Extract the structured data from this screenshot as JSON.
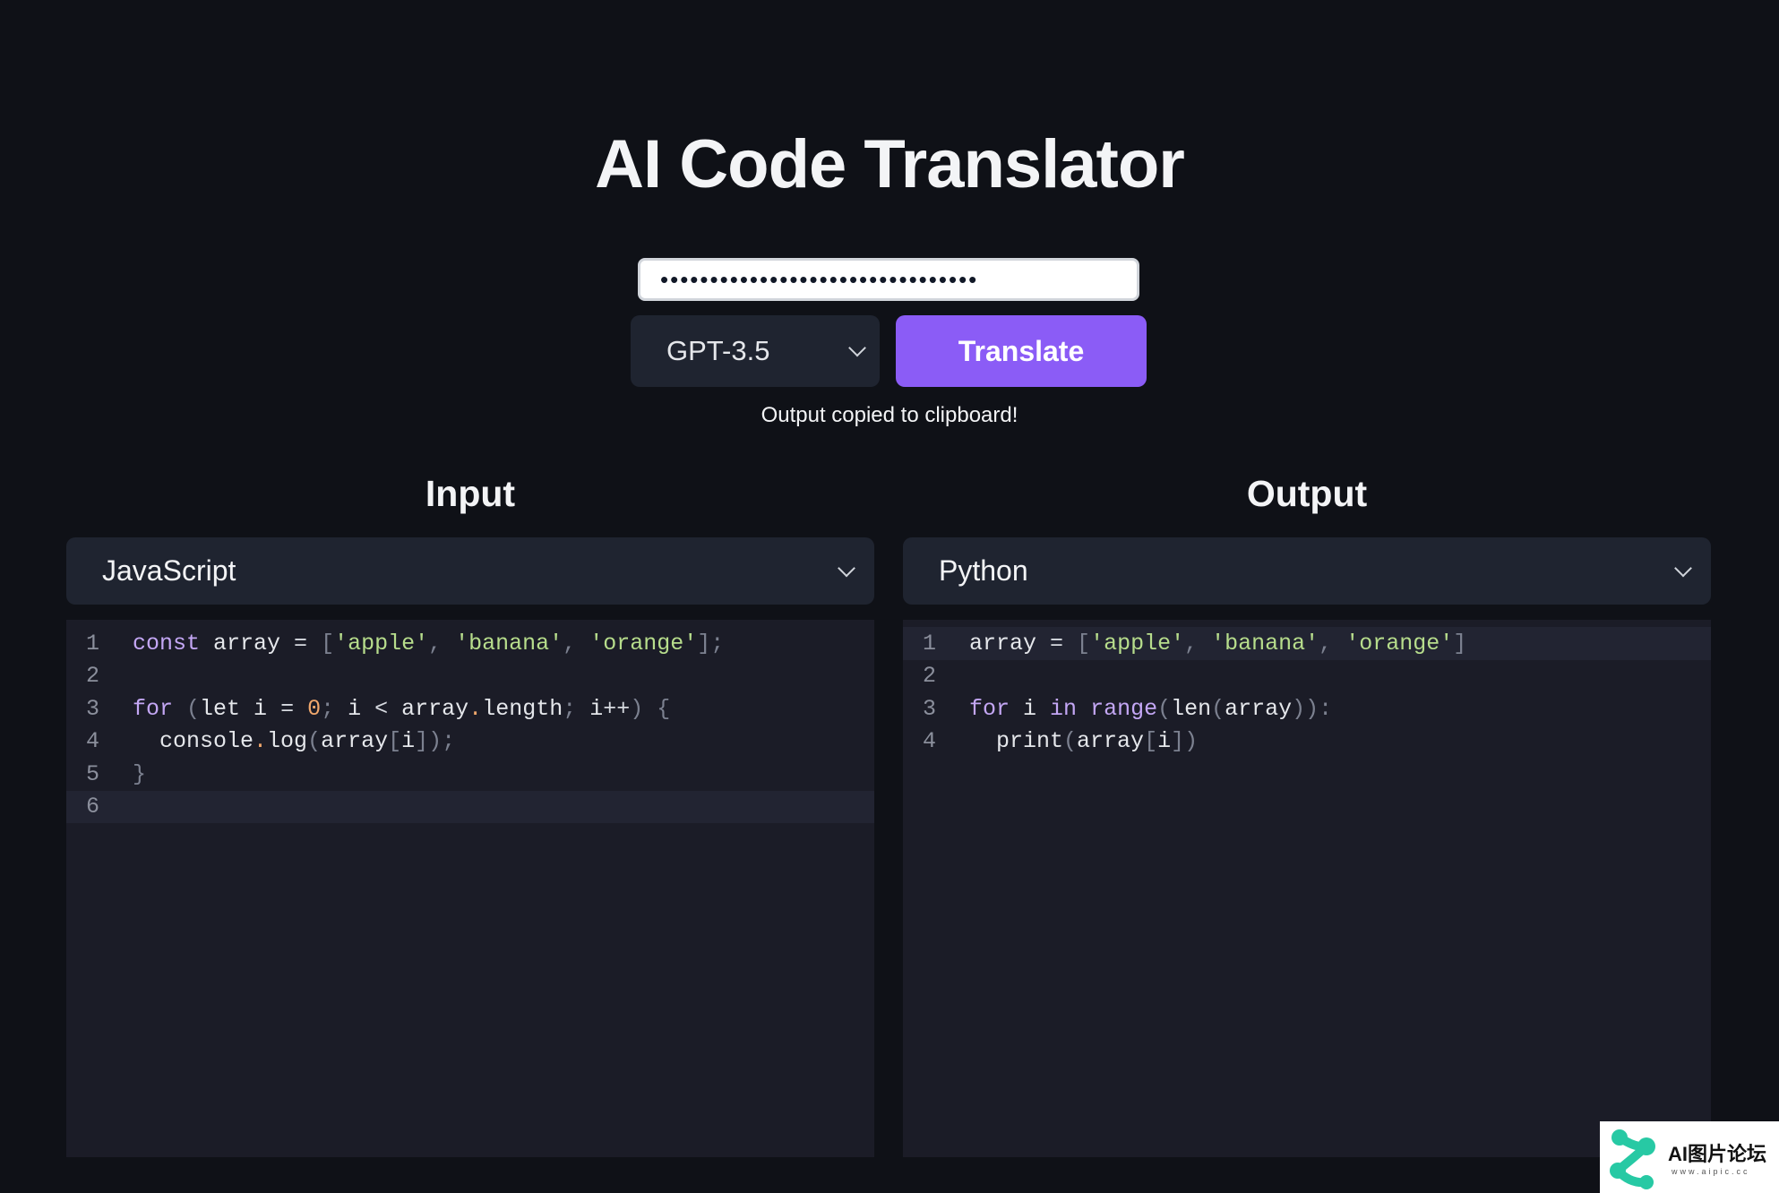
{
  "app": {
    "title": "AI Code Translator",
    "api_key_value": "••••••••••••••••••••••••••••••••",
    "model_selected": "GPT-3.5",
    "translate_label": "Translate",
    "status_message": "Output copied to clipboard!"
  },
  "input": {
    "heading": "Input",
    "language": "JavaScript",
    "line_numbers": [
      "1",
      "2",
      "3",
      "4",
      "5",
      "6"
    ]
  },
  "output": {
    "heading": "Output",
    "language": "Python",
    "line_numbers": [
      "1",
      "2",
      "3",
      "4"
    ]
  },
  "watermark": {
    "text": "AI图片论坛",
    "sub": "www.aipic.cc"
  }
}
